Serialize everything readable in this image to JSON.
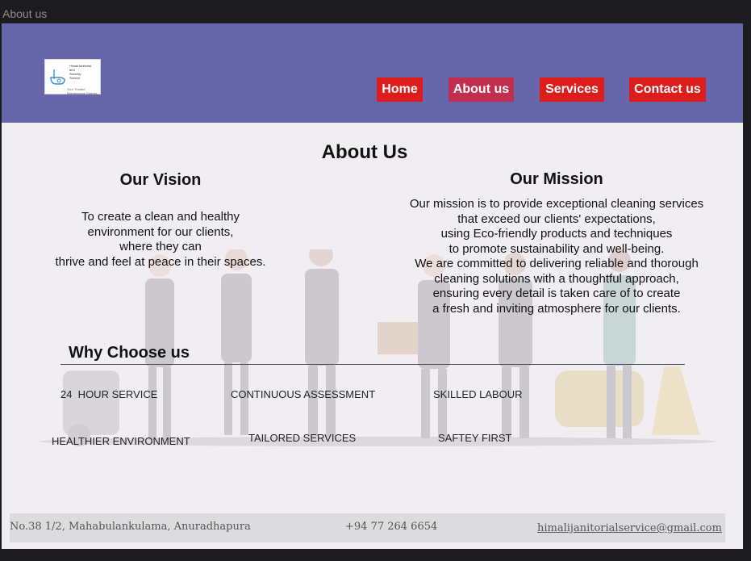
{
  "window": {
    "title": "About us"
  },
  "header": {
    "logo": {
      "line1": "HimaliJanitorial",
      "line2": "and",
      "line3": "Security",
      "line4": "Service",
      "tagline": "Your Trusted Maintenance Partner"
    },
    "nav": [
      {
        "label": "Home"
      },
      {
        "label": "About us"
      },
      {
        "label": "Services"
      },
      {
        "label": "Contact us"
      }
    ]
  },
  "main": {
    "title": "About Us",
    "vision": {
      "heading": "Our Vision",
      "lines": [
        "To create a clean and healthy",
        "environment for our clients,",
        "where they can",
        "thrive and feel at peace in their spaces."
      ]
    },
    "mission": {
      "heading": "Our Mission",
      "lines": [
        "Our mission is to provide exceptional cleaning services",
        "that exceed our clients' expectations,",
        "using Eco-friendly products and techniques",
        "to promote sustainability and well-being.",
        "We are committed to delivering reliable and thorough",
        "cleaning solutions with a thoughtful approach,",
        "ensuring every detail is taken care of to create",
        "a fresh and inviting atmosphere for our clients."
      ]
    },
    "why": {
      "heading": "Why Choose us",
      "features": [
        "24  HOUR SERVICE",
        "CONTINUOUS ASSESSMENT",
        "SKILLED LABOUR",
        "HEALTHIER ENVIRONMENT",
        "TAILORED SERVICES",
        "SAFTEY FIRST"
      ]
    }
  },
  "footer": {
    "address": "No.38 1/2, Mahabulankulama, Anuradhapura",
    "phone": "+94 77 264 6654",
    "email": "himalijanitorialservice@gmail.com"
  },
  "colors": {
    "header_bg": "#6667ab",
    "nav_button": "#dd1c1c",
    "nav_button_active": "#c0304e",
    "page_bg": "#f1eef3",
    "footer_bg": "#dcdbdd"
  }
}
